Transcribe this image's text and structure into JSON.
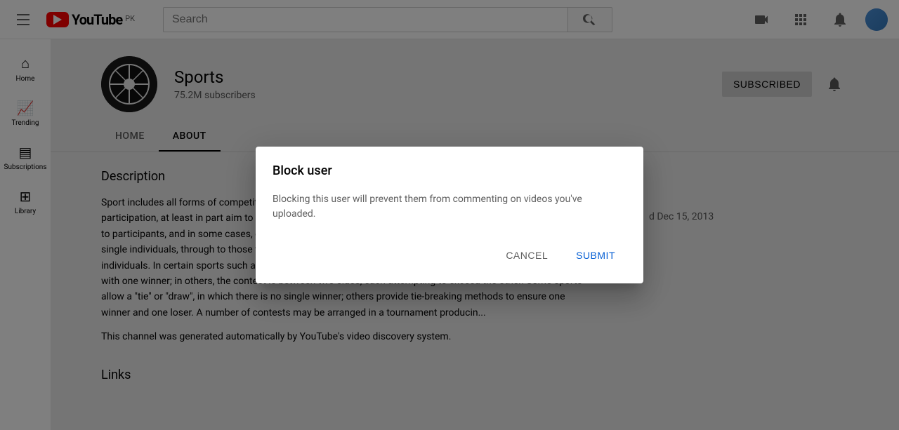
{
  "topbar": {
    "logo_text": "YouTube",
    "logo_pk": "PK",
    "search_placeholder": "Search"
  },
  "sidebar": {
    "items": [
      {
        "label": "Home",
        "icon": "🏠"
      },
      {
        "label": "Trending",
        "icon": "🔥"
      },
      {
        "label": "Subscriptions",
        "icon": "📺"
      },
      {
        "label": "Library",
        "icon": "📚"
      }
    ]
  },
  "channel": {
    "name": "Sports",
    "subscribers": "75.2M subscribers",
    "subscribed_btn": "SUBSCRIBED",
    "tabs": [
      {
        "label": "HOME",
        "active": false
      },
      {
        "label": "ABOUT",
        "active": true
      }
    ],
    "description_title": "Description",
    "description": "Sport includes all forms of competitive physical activity or games which, through casual or organised participation, at least in part aim to use, maintain or improve physical ability and skills while providing enjoyment to participants, and in some cases, entertainment for spectators. Hundreds of sports exist, from those between single individuals, through to those with hundreds of simultaneous participants, either in teams or competing as individuals. In certain sports such as racing, many contestants may compete, simultaneously or consecutively, with one winner; in others, the contest is between two sides, each attempting to exceed the other. Some sports allow a \"tie\" or \"draw\", in which there is no single winner; others provide tie-breaking methods to ensure one winner and one loser. A number of contests may be arranged in a tournament producin...",
    "auto_generated": "This channel was generated automatically by YouTube's video discovery system.",
    "stats_label": "d Dec 15, 2013",
    "links_title": "Links"
  },
  "dialog": {
    "title": "Block user",
    "body": "Blocking this user will prevent them from commenting on videos you've uploaded.",
    "cancel_label": "CANCEL",
    "submit_label": "SUBMIT"
  }
}
